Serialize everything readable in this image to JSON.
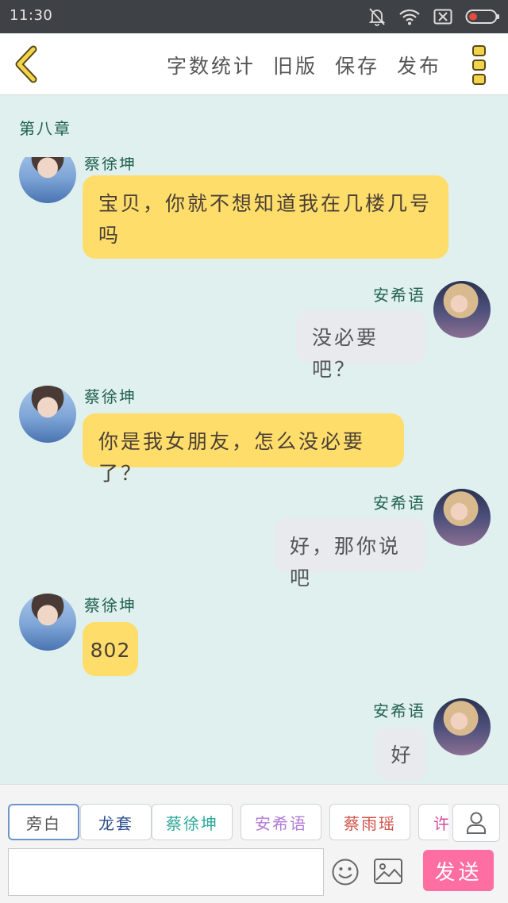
{
  "status_bar": {
    "time": "11:30",
    "icons": [
      "bell-off-icon",
      "wifi-icon",
      "sim-x-icon",
      "battery-icon"
    ]
  },
  "header": {
    "back_icon": "chevron-left-icon",
    "menu": [
      "字数统计",
      "旧版",
      "保存",
      "发布"
    ],
    "more_icon": "vertical-dots-icon",
    "accent_color": "#f2d44c"
  },
  "chat": {
    "chapter": "第八章",
    "messages": [
      {
        "side": "left",
        "speaker": "蔡徐坤",
        "text": "宝贝，你就不想知道我在几楼几号吗"
      },
      {
        "side": "right",
        "speaker": "安希语",
        "text": "没必要吧？"
      },
      {
        "side": "left",
        "speaker": "蔡徐坤",
        "text": "你是我女朋友，怎么没必要了？"
      },
      {
        "side": "right",
        "speaker": "安希语",
        "text": "好，那你说吧"
      },
      {
        "side": "left",
        "speaker": "蔡徐坤",
        "text": "802"
      },
      {
        "side": "right",
        "speaker": "安希语",
        "text": "好"
      }
    ],
    "bubble_colors": {
      "left": "#ffdd6b",
      "right": "#e8eaee"
    }
  },
  "input": {
    "characters": [
      {
        "label": "旁白",
        "color": "#555555"
      },
      {
        "label": "龙套",
        "color": "#2c4f8c"
      },
      {
        "label": "蔡徐坤",
        "color": "#2fa89a"
      },
      {
        "label": "安希语",
        "color": "#b37ad6"
      },
      {
        "label": "蔡雨瑶",
        "color": "#d2524a"
      },
      {
        "label": "许",
        "color": "#d04a9a"
      }
    ],
    "person_icon": "person-icon",
    "placeholder": "",
    "emoji_icon": "smiley-icon",
    "image_icon": "image-icon",
    "send_label": "发送",
    "send_color": "#ff6ea1"
  }
}
